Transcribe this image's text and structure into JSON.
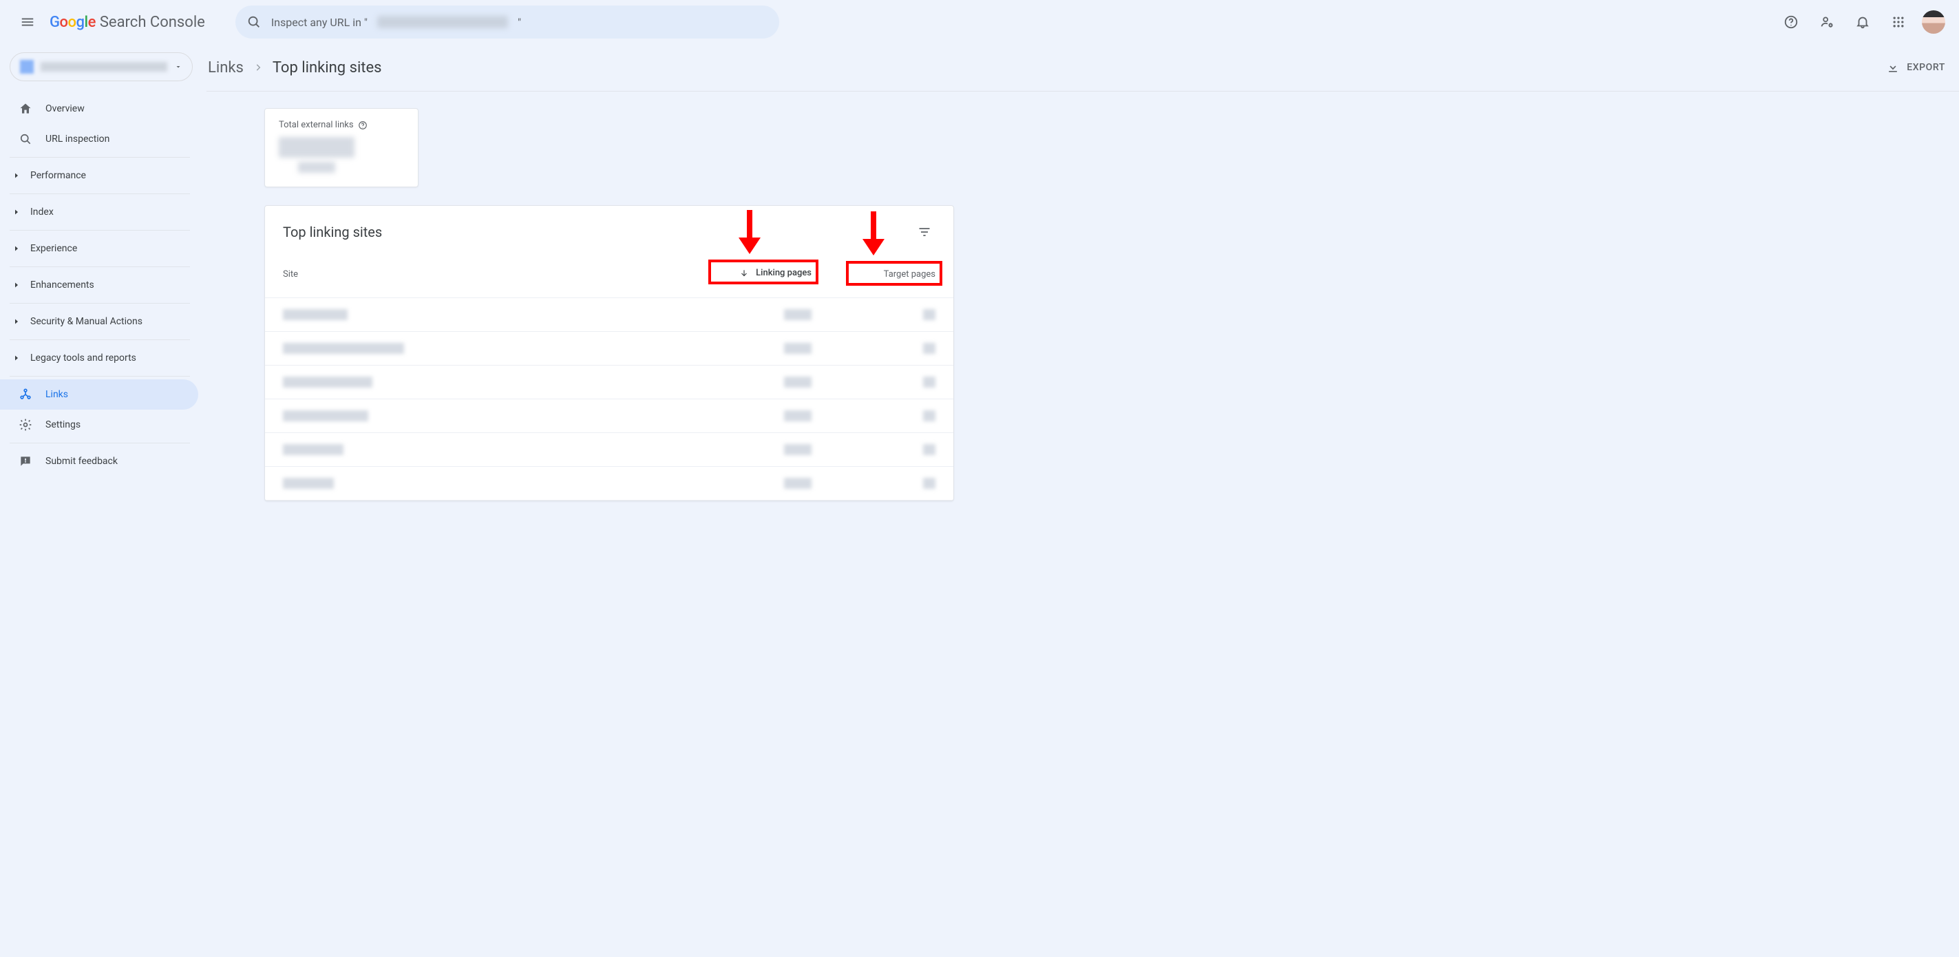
{
  "app": {
    "name": "Search Console"
  },
  "search": {
    "placeholder_prefix": "Inspect any URL in \"",
    "placeholder_suffix": "\"",
    "domain_redacted": true
  },
  "property": {
    "name_redacted": true
  },
  "sidebar": {
    "items": [
      {
        "label": "Overview",
        "icon": "home"
      },
      {
        "label": "URL inspection",
        "icon": "search"
      }
    ],
    "sections": [
      {
        "label": "Performance"
      },
      {
        "label": "Index"
      },
      {
        "label": "Experience"
      },
      {
        "label": "Enhancements"
      },
      {
        "label": "Security & Manual Actions"
      },
      {
        "label": "Legacy tools and reports"
      }
    ],
    "bottom": [
      {
        "label": "Links",
        "icon": "links",
        "active": true
      },
      {
        "label": "Settings",
        "icon": "gear"
      }
    ],
    "footer": [
      {
        "label": "Submit feedback",
        "icon": "feedback"
      }
    ]
  },
  "breadcrumb": {
    "root": "Links",
    "current": "Top linking sites"
  },
  "actions": {
    "export_label": "EXPORT"
  },
  "stat_card": {
    "label": "Total external links",
    "value_redacted": true
  },
  "table": {
    "title": "Top linking sites",
    "columns": {
      "site": "Site",
      "linking": "Linking pages",
      "target": "Target pages"
    },
    "sort": {
      "column": "linking",
      "dir": "desc"
    },
    "rows": [
      {
        "site_redacted": true,
        "site_w": 94,
        "linking_redacted": true,
        "target_redacted": true
      },
      {
        "site_redacted": true,
        "site_w": 176,
        "linking_redacted": true,
        "target_redacted": true
      },
      {
        "site_redacted": true,
        "site_w": 130,
        "linking_redacted": true,
        "target_redacted": true
      },
      {
        "site_redacted": true,
        "site_w": 124,
        "linking_redacted": true,
        "target_redacted": true
      },
      {
        "site_redacted": true,
        "site_w": 88,
        "linking_redacted": true,
        "target_redacted": true
      },
      {
        "site_redacted": true,
        "site_w": 74,
        "linking_redacted": true,
        "target_redacted": true
      }
    ]
  },
  "annotations": {
    "highlight_columns": [
      "linking",
      "target"
    ],
    "arrows": [
      "linking",
      "target"
    ]
  }
}
